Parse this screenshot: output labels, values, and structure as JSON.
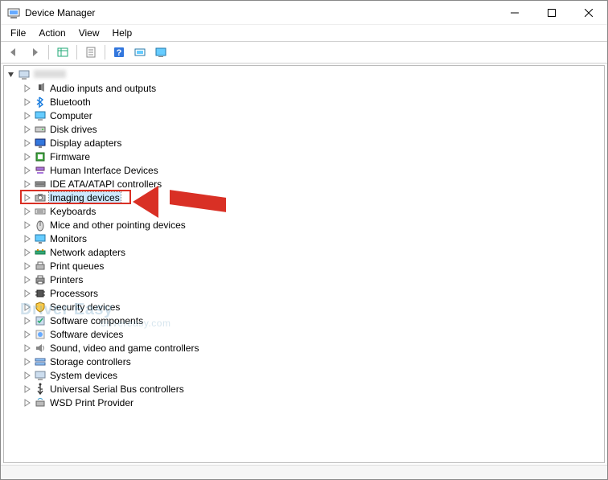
{
  "window": {
    "title": "Device Manager"
  },
  "menu": {
    "items": [
      "File",
      "Action",
      "View",
      "Help"
    ]
  },
  "toolbar": {
    "buttons": [
      {
        "name": "back-icon"
      },
      {
        "name": "forward-icon"
      },
      {
        "sep": true
      },
      {
        "name": "show-hidden-icon"
      },
      {
        "sep": true
      },
      {
        "name": "properties-icon"
      },
      {
        "sep": true
      },
      {
        "name": "help-icon"
      },
      {
        "name": "scan-icon"
      },
      {
        "name": "monitor-icon"
      }
    ]
  },
  "tree": {
    "root": {
      "label": "",
      "expanded": true,
      "blurred": true
    },
    "children": [
      {
        "label": "Audio inputs and outputs",
        "icon": "audio"
      },
      {
        "label": "Bluetooth",
        "icon": "bluetooth"
      },
      {
        "label": "Computer",
        "icon": "computer"
      },
      {
        "label": "Disk drives",
        "icon": "disk"
      },
      {
        "label": "Display adapters",
        "icon": "display"
      },
      {
        "label": "Firmware",
        "icon": "firmware"
      },
      {
        "label": "Human Interface Devices",
        "icon": "hid"
      },
      {
        "label": "IDE ATA/ATAPI controllers",
        "icon": "ide"
      },
      {
        "label": "Imaging devices",
        "icon": "imaging",
        "selected": true,
        "highlighted": true
      },
      {
        "label": "Keyboards",
        "icon": "keyboard"
      },
      {
        "label": "Mice and other pointing devices",
        "icon": "mouse"
      },
      {
        "label": "Monitors",
        "icon": "monitor"
      },
      {
        "label": "Network adapters",
        "icon": "network"
      },
      {
        "label": "Print queues",
        "icon": "printqueue"
      },
      {
        "label": "Printers",
        "icon": "printer"
      },
      {
        "label": "Processors",
        "icon": "cpu"
      },
      {
        "label": "Security devices",
        "icon": "security"
      },
      {
        "label": "Software components",
        "icon": "swcomp"
      },
      {
        "label": "Software devices",
        "icon": "swdev"
      },
      {
        "label": "Sound, video and game controllers",
        "icon": "sound"
      },
      {
        "label": "Storage controllers",
        "icon": "storage"
      },
      {
        "label": "System devices",
        "icon": "system"
      },
      {
        "label": "Universal Serial Bus controllers",
        "icon": "usb"
      },
      {
        "label": "WSD Print Provider",
        "icon": "wsd"
      }
    ]
  },
  "watermark": {
    "main": "Driver Easy",
    "sub": "drivereasy.com"
  }
}
